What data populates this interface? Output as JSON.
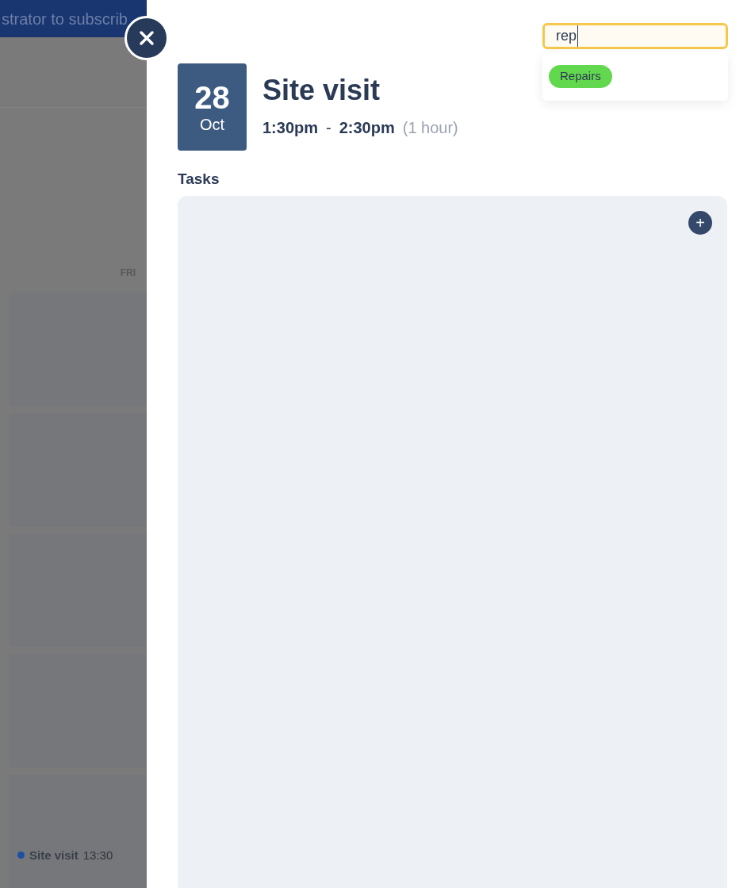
{
  "background": {
    "banner": "strator to subscrib",
    "day_header": "FRI",
    "cells": [
      {},
      {},
      {},
      {},
      {
        "events": [
          {
            "title": "Site visit",
            "time": "13:30",
            "color": "#1d4fa3"
          }
        ]
      }
    ]
  },
  "event": {
    "day": "28",
    "month": "Oct",
    "title": "Site visit",
    "start": "1:30pm",
    "separator": "-",
    "end": "2:30pm",
    "duration": "(1 hour)"
  },
  "tag_search": {
    "value": "rep",
    "focused": true,
    "results": [
      {
        "label": "Repairs",
        "color": "#62d84e"
      }
    ]
  },
  "tasks": {
    "heading": "Tasks",
    "add_button": "+"
  }
}
